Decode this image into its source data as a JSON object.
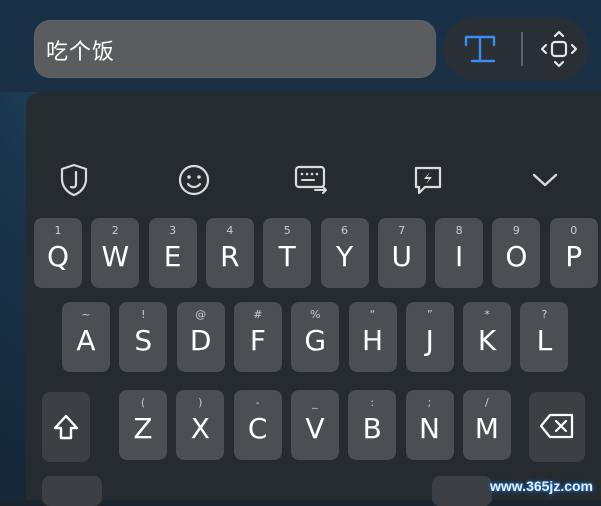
{
  "input": {
    "value": "吃个饭"
  },
  "top_icons": [
    "text-format-icon",
    "cursor-move-icon"
  ],
  "toolbar": [
    "shield-icon",
    "emoji-icon",
    "keyboard-settings-icon",
    "quick-reply-icon",
    "collapse-chevron-icon"
  ],
  "rows": [
    [
      {
        "k": "Q",
        "h": "1"
      },
      {
        "k": "W",
        "h": "2"
      },
      {
        "k": "E",
        "h": "3"
      },
      {
        "k": "R",
        "h": "4"
      },
      {
        "k": "T",
        "h": "5"
      },
      {
        "k": "Y",
        "h": "6"
      },
      {
        "k": "U",
        "h": "7"
      },
      {
        "k": "I",
        "h": "8"
      },
      {
        "k": "O",
        "h": "9"
      },
      {
        "k": "P",
        "h": "0"
      }
    ],
    [
      {
        "k": "A",
        "h": "~"
      },
      {
        "k": "S",
        "h": "!"
      },
      {
        "k": "D",
        "h": "@"
      },
      {
        "k": "F",
        "h": "#"
      },
      {
        "k": "G",
        "h": "%"
      },
      {
        "k": "H",
        "h": "“"
      },
      {
        "k": "J",
        "h": "”"
      },
      {
        "k": "K",
        "h": "*"
      },
      {
        "k": "L",
        "h": "?"
      }
    ],
    [
      {
        "k": "Z",
        "h": "("
      },
      {
        "k": "X",
        "h": ")"
      },
      {
        "k": "C",
        "h": "-"
      },
      {
        "k": "V",
        "h": "_"
      },
      {
        "k": "B",
        "h": ":"
      },
      {
        "k": "N",
        "h": ";"
      },
      {
        "k": "M",
        "h": "/"
      }
    ]
  ],
  "watermark": "www.365jz.com"
}
